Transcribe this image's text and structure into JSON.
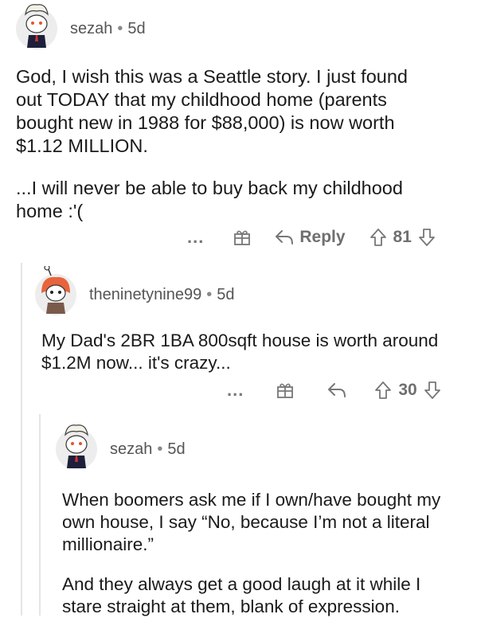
{
  "comments": [
    {
      "username": "sezah",
      "age": "5d",
      "paragraphs": [
        "God, I wish this was a Seattle story. I just found out TODAY that my childhood home (parents bought new in 1988 for $88,000) is now worth $1.12 MILLION.",
        "...I will never be able to buy back my childhood home :'("
      ],
      "more_label": "...",
      "reply_label": "Reply",
      "votes": "81"
    },
    {
      "username": "theninetynine99",
      "age": "5d",
      "paragraphs": [
        "My Dad's 2BR 1BA 800sqft house is worth around $1.2M now... it's crazy..."
      ],
      "more_label": "...",
      "votes": "30"
    },
    {
      "username": "sezah",
      "age": "5d",
      "paragraphs": [
        "When boomers ask me if I own/have bought my own house, I say “No, because I’m not a literal millionaire.”",
        "And they always get a good laugh at it while I stare straight at them, blank of expression."
      ]
    }
  ],
  "separator": "•",
  "icons": [
    "avatar",
    "more-icon",
    "gift-icon",
    "reply-icon",
    "upvote-icon",
    "downvote-icon"
  ]
}
